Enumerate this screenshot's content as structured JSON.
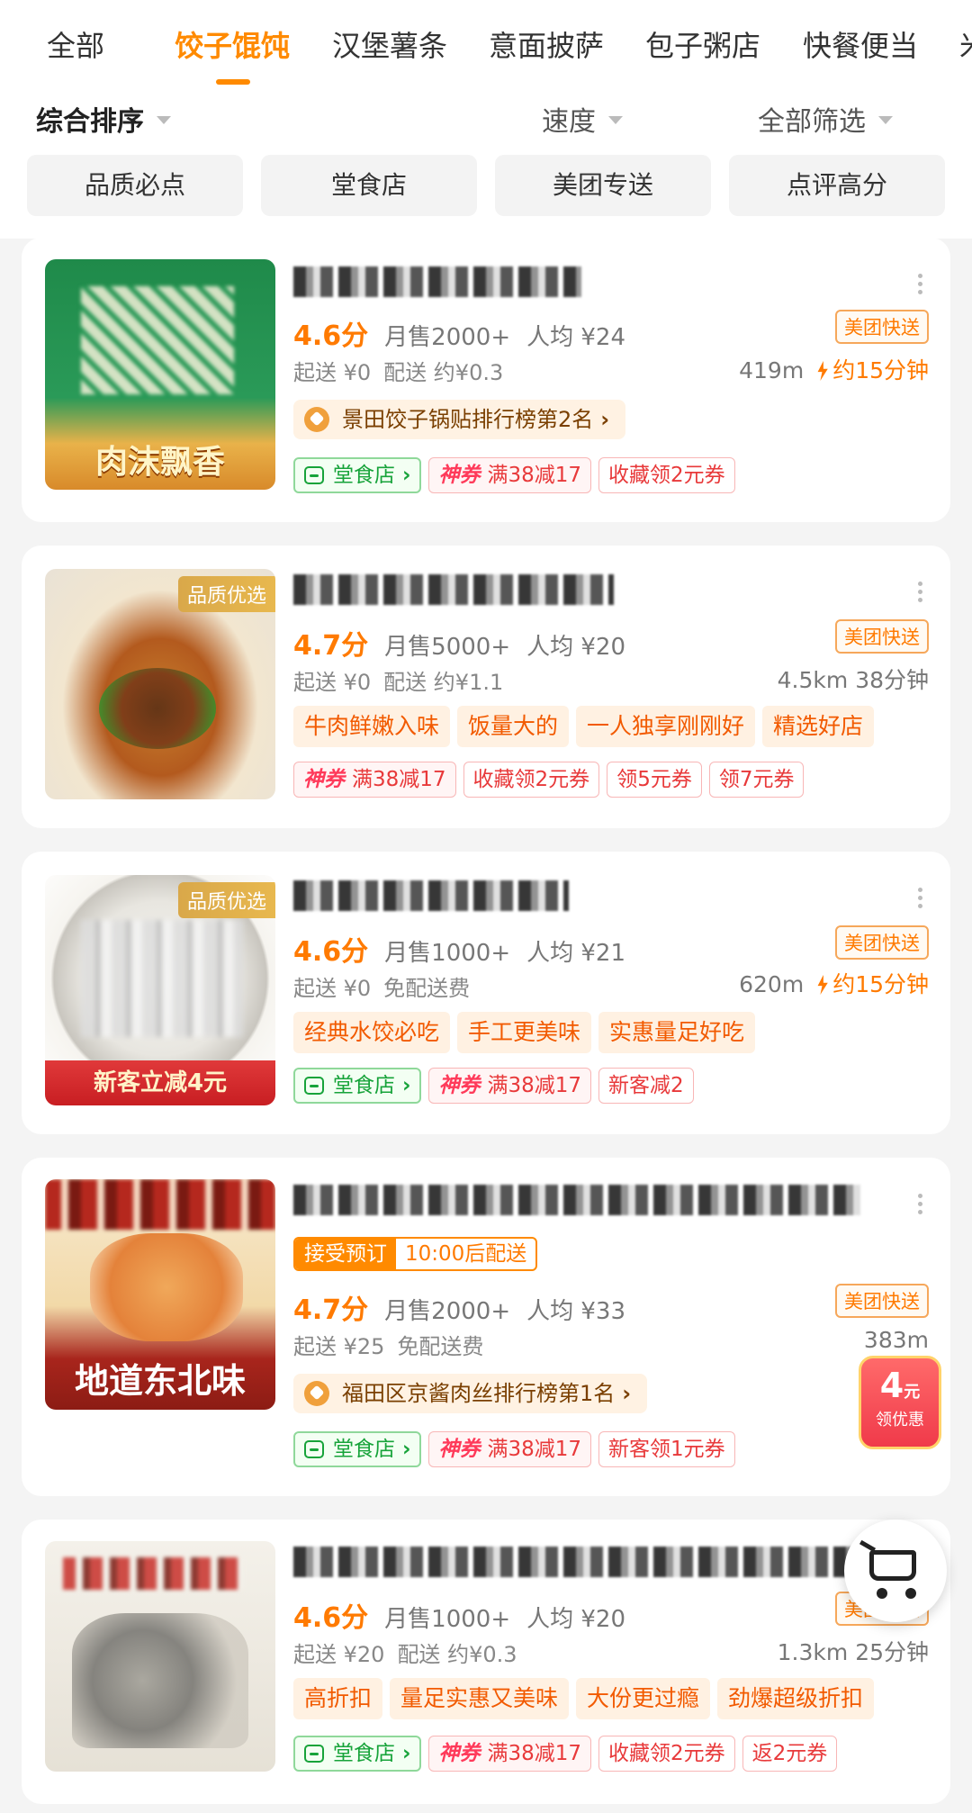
{
  "categories": [
    "全部",
    "饺子馄饨",
    "汉堡薯条",
    "意面披萨",
    "包子粥店",
    "快餐便当",
    "米"
  ],
  "active_category": "饺子馄饨",
  "sort": {
    "composite": "综合排序",
    "speed": "速度",
    "filter": "全部筛选"
  },
  "quick_filters": [
    "品质必点",
    "堂食店",
    "美团专送",
    "点评高分"
  ],
  "stores": [
    {
      "image_caption": "肉沫飘香",
      "rating": "4.6分",
      "monthly_sales": "月售2000+",
      "avg_price": "人均 ¥24",
      "delivery_badge": "美团快送",
      "min_order": "起送 ¥0",
      "delivery_fee": "配送 约¥0.3",
      "distance": "419m",
      "eta": "约15分钟",
      "rank": "景田饺子锅贴排行榜第2名",
      "dine_in": "堂食店",
      "coupon_label": "神券",
      "coupon_value": "满38减17",
      "extra_coupons": [
        "收藏领2元券"
      ]
    },
    {
      "image_badge": "品质优选",
      "rating": "4.7分",
      "monthly_sales": "月售5000+",
      "avg_price": "人均 ¥20",
      "delivery_badge": "美团快送",
      "min_order": "起送 ¥0",
      "delivery_fee": "配送 约¥1.1",
      "distance": "4.5km",
      "eta": "38分钟",
      "features": [
        "牛肉鲜嫩入味",
        "饭量大的",
        "一人独享刚刚好",
        "精选好店"
      ],
      "coupon_label": "神券",
      "coupon_value": "满38减17",
      "extra_coupons": [
        "收藏领2元券",
        "领5元券",
        "领7元券"
      ]
    },
    {
      "image_badge": "品质优选",
      "image_caption": "新客立减4元",
      "rating": "4.6分",
      "monthly_sales": "月售1000+",
      "avg_price": "人均 ¥21",
      "delivery_badge": "美团快送",
      "min_order": "起送 ¥0",
      "delivery_fee": "免配送费",
      "distance": "620m",
      "eta": "约15分钟",
      "features": [
        "经典水饺必吃",
        "手工更美味",
        "实惠量足好吃"
      ],
      "dine_in": "堂食店",
      "coupon_label": "神券",
      "coupon_value": "满38减17",
      "extra_coupons": [
        "新客减2"
      ]
    },
    {
      "image_caption": "地道东北味",
      "preorder": "接受预订",
      "preorder_time": "10:00后配送",
      "rating": "4.7分",
      "monthly_sales": "月售2000+",
      "avg_price": "人均 ¥33",
      "delivery_badge": "美团快送",
      "min_order": "起送 ¥25",
      "delivery_fee": "免配送费",
      "distance": "383m",
      "rank": "福田区京酱肉丝排行榜第1名",
      "dine_in": "堂食店",
      "coupon_label": "神券",
      "coupon_value": "满38减17",
      "extra_coupons": [
        "新客领1元券"
      ]
    },
    {
      "rating": "4.6分",
      "monthly_sales": "月售1000+",
      "avg_price": "人均 ¥20",
      "delivery_badge": "美团快送",
      "min_order": "起送 ¥20",
      "delivery_fee": "配送 约¥0.3",
      "distance": "1.3km",
      "eta": "25分钟",
      "features": [
        "高折扣",
        "量足实惠又美味",
        "大份更过瘾",
        "劲爆超级折扣"
      ],
      "dine_in": "堂食店",
      "coupon_label": "神券",
      "coupon_value": "满38减17",
      "extra_coupons": [
        "收藏领2元券",
        "返2元券"
      ]
    }
  ],
  "float_coupon": {
    "amount": "4",
    "unit": "元",
    "label": "领优惠"
  },
  "colors": {
    "accent": "#ff8a00",
    "coupon_red": "#e8393a",
    "dine_green": "#17a33a"
  }
}
